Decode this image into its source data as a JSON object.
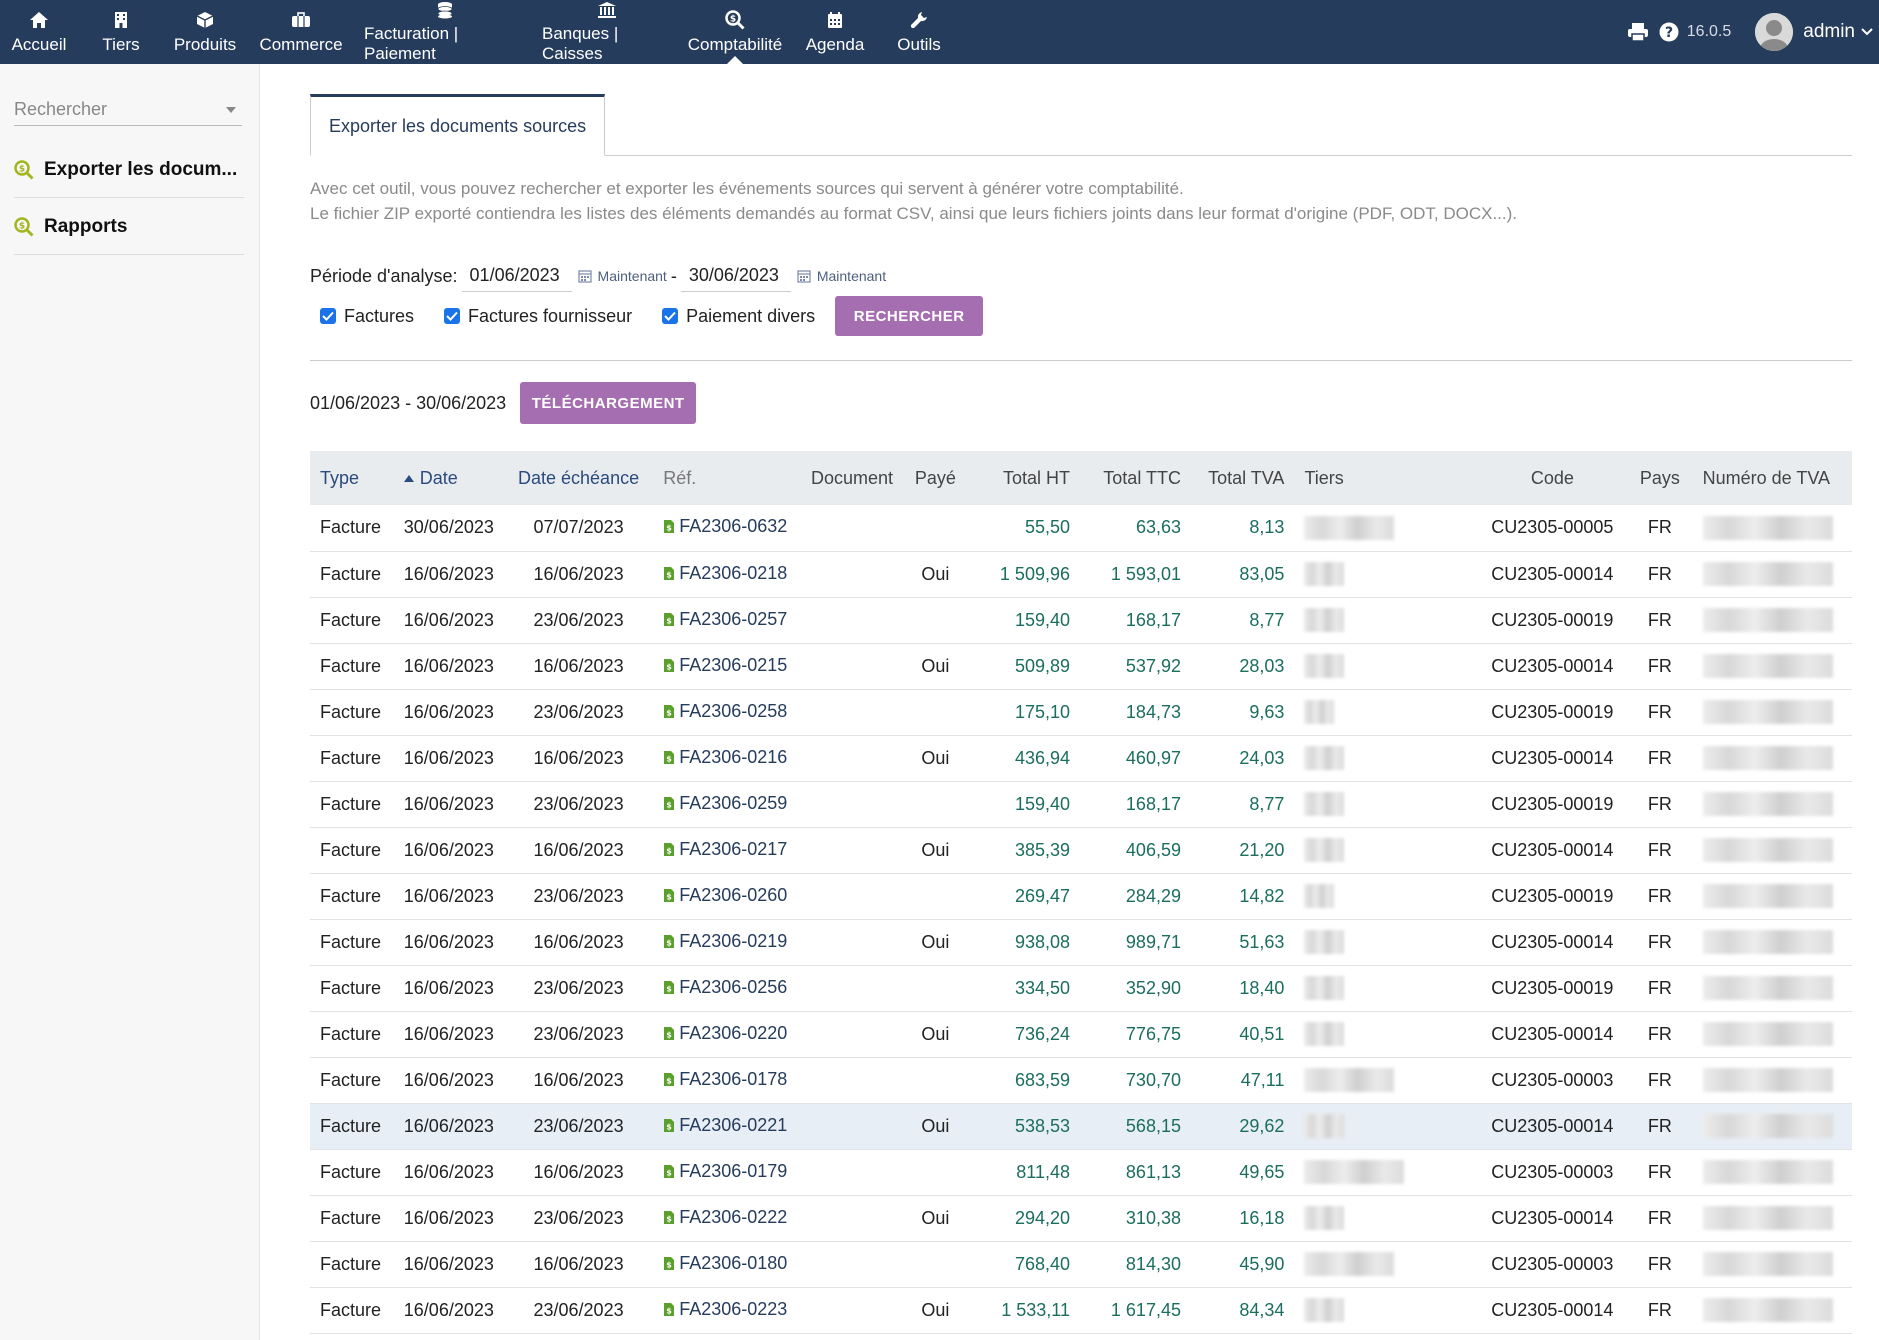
{
  "topbar": {
    "nav": [
      {
        "label": "Accueil",
        "icon": "home-icon"
      },
      {
        "label": "Tiers",
        "icon": "building-icon"
      },
      {
        "label": "Produits",
        "icon": "cube-icon"
      },
      {
        "label": "Commerce",
        "icon": "briefcase-icon"
      },
      {
        "label": "Facturation | Paiement",
        "icon": "coins-icon"
      },
      {
        "label": "Banques | Caisses",
        "icon": "bank-icon"
      },
      {
        "label": "Comptabilité",
        "icon": "search-dollar-icon"
      },
      {
        "label": "Agenda",
        "icon": "calendar-icon"
      },
      {
        "label": "Outils",
        "icon": "wrench-icon"
      }
    ],
    "version": "16.0.5",
    "user": "admin"
  },
  "sidebar": {
    "search_placeholder": "Rechercher",
    "items": [
      {
        "label": "Exporter les docum..."
      },
      {
        "label": "Rapports"
      }
    ]
  },
  "main": {
    "tab_label": "Exporter les documents sources",
    "description_line1": "Avec cet outil, vous pouvez rechercher et exporter les événements sources qui servent à générer votre comptabilité.",
    "description_line2": "Le fichier ZIP exporté contiendra les listes des éléments demandés au format CSV, ainsi que leurs fichiers joints dans leur format d'origine (PDF, ODT, DOCX...).",
    "periode_label": "Période d'analyse:",
    "date_start": "01/06/2023",
    "date_end": "30/06/2023",
    "now_label": "Maintenant",
    "dash": "-",
    "checkboxes": [
      {
        "label": "Factures",
        "checked": true
      },
      {
        "label": "Factures fournisseur",
        "checked": true
      },
      {
        "label": "Paiement divers",
        "checked": true
      }
    ],
    "search_button": "RECHERCHER",
    "range_text": "01/06/2023 - 30/06/2023",
    "download_button": "TÉLÉCHARGEMENT"
  },
  "table": {
    "headers": {
      "type": "Type",
      "date": "Date",
      "due": "Date échéance",
      "ref": "Réf.",
      "document": "Document",
      "paid": "Payé",
      "ht": "Total HT",
      "ttc": "Total TTC",
      "tva": "Total TVA",
      "tiers": "Tiers",
      "code": "Code",
      "country": "Pays",
      "vat": "Numéro de TVA"
    },
    "rows": [
      {
        "type": "Facture",
        "date": "30/06/2023",
        "due": "07/07/2023",
        "ref": "FA2306-0632",
        "paid": "",
        "ht": "55,50",
        "ttc": "63,63",
        "tva": "8,13",
        "code": "CU2305-00005",
        "country": "FR"
      },
      {
        "type": "Facture",
        "date": "16/06/2023",
        "due": "16/06/2023",
        "ref": "FA2306-0218",
        "paid": "Oui",
        "ht": "1 509,96",
        "ttc": "1 593,01",
        "tva": "83,05",
        "code": "CU2305-00014",
        "country": "FR"
      },
      {
        "type": "Facture",
        "date": "16/06/2023",
        "due": "23/06/2023",
        "ref": "FA2306-0257",
        "paid": "",
        "ht": "159,40",
        "ttc": "168,17",
        "tva": "8,77",
        "code": "CU2305-00019",
        "country": "FR"
      },
      {
        "type": "Facture",
        "date": "16/06/2023",
        "due": "16/06/2023",
        "ref": "FA2306-0215",
        "paid": "Oui",
        "ht": "509,89",
        "ttc": "537,92",
        "tva": "28,03",
        "code": "CU2305-00014",
        "country": "FR"
      },
      {
        "type": "Facture",
        "date": "16/06/2023",
        "due": "23/06/2023",
        "ref": "FA2306-0258",
        "paid": "",
        "ht": "175,10",
        "ttc": "184,73",
        "tva": "9,63",
        "code": "CU2305-00019",
        "country": "FR"
      },
      {
        "type": "Facture",
        "date": "16/06/2023",
        "due": "16/06/2023",
        "ref": "FA2306-0216",
        "paid": "Oui",
        "ht": "436,94",
        "ttc": "460,97",
        "tva": "24,03",
        "code": "CU2305-00014",
        "country": "FR"
      },
      {
        "type": "Facture",
        "date": "16/06/2023",
        "due": "23/06/2023",
        "ref": "FA2306-0259",
        "paid": "",
        "ht": "159,40",
        "ttc": "168,17",
        "tva": "8,77",
        "code": "CU2305-00019",
        "country": "FR"
      },
      {
        "type": "Facture",
        "date": "16/06/2023",
        "due": "16/06/2023",
        "ref": "FA2306-0217",
        "paid": "Oui",
        "ht": "385,39",
        "ttc": "406,59",
        "tva": "21,20",
        "code": "CU2305-00014",
        "country": "FR"
      },
      {
        "type": "Facture",
        "date": "16/06/2023",
        "due": "23/06/2023",
        "ref": "FA2306-0260",
        "paid": "",
        "ht": "269,47",
        "ttc": "284,29",
        "tva": "14,82",
        "code": "CU2305-00019",
        "country": "FR"
      },
      {
        "type": "Facture",
        "date": "16/06/2023",
        "due": "16/06/2023",
        "ref": "FA2306-0219",
        "paid": "Oui",
        "ht": "938,08",
        "ttc": "989,71",
        "tva": "51,63",
        "code": "CU2305-00014",
        "country": "FR"
      },
      {
        "type": "Facture",
        "date": "16/06/2023",
        "due": "23/06/2023",
        "ref": "FA2306-0256",
        "paid": "",
        "ht": "334,50",
        "ttc": "352,90",
        "tva": "18,40",
        "code": "CU2305-00019",
        "country": "FR"
      },
      {
        "type": "Facture",
        "date": "16/06/2023",
        "due": "23/06/2023",
        "ref": "FA2306-0220",
        "paid": "Oui",
        "ht": "736,24",
        "ttc": "776,75",
        "tva": "40,51",
        "code": "CU2305-00014",
        "country": "FR"
      },
      {
        "type": "Facture",
        "date": "16/06/2023",
        "due": "16/06/2023",
        "ref": "FA2306-0178",
        "paid": "",
        "ht": "683,59",
        "ttc": "730,70",
        "tva": "47,11",
        "code": "CU2305-00003",
        "country": "FR"
      },
      {
        "type": "Facture",
        "date": "16/06/2023",
        "due": "23/06/2023",
        "ref": "FA2306-0221",
        "paid": "Oui",
        "ht": "538,53",
        "ttc": "568,15",
        "tva": "29,62",
        "code": "CU2305-00014",
        "country": "FR",
        "highlighted": true
      },
      {
        "type": "Facture",
        "date": "16/06/2023",
        "due": "16/06/2023",
        "ref": "FA2306-0179",
        "paid": "",
        "ht": "811,48",
        "ttc": "861,13",
        "tva": "49,65",
        "code": "CU2305-00003",
        "country": "FR"
      },
      {
        "type": "Facture",
        "date": "16/06/2023",
        "due": "23/06/2023",
        "ref": "FA2306-0222",
        "paid": "Oui",
        "ht": "294,20",
        "ttc": "310,38",
        "tva": "16,18",
        "code": "CU2305-00014",
        "country": "FR"
      },
      {
        "type": "Facture",
        "date": "16/06/2023",
        "due": "16/06/2023",
        "ref": "FA2306-0180",
        "paid": "",
        "ht": "768,40",
        "ttc": "814,30",
        "tva": "45,90",
        "code": "CU2305-00003",
        "country": "FR"
      },
      {
        "type": "Facture",
        "date": "16/06/2023",
        "due": "23/06/2023",
        "ref": "FA2306-0223",
        "paid": "Oui",
        "ht": "1 533,11",
        "ttc": "1 617,45",
        "tva": "84,34",
        "code": "CU2305-00014",
        "country": "FR"
      }
    ]
  },
  "colors": {
    "topbar": "#263c5c",
    "button": "#a56eb0",
    "amount": "#1b6e5e",
    "link": "#263c5c",
    "file_icon": "#5aa02c"
  }
}
